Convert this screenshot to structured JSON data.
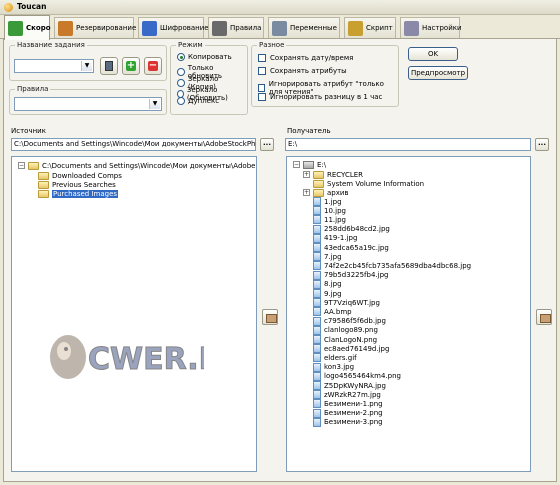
{
  "window": {
    "title": "Toucan"
  },
  "tabs": [
    {
      "label": "Скоро",
      "color": "#3a9a3a",
      "active": true
    },
    {
      "label": "Резервирование",
      "color": "#c87a2a"
    },
    {
      "label": "Шифрование",
      "color": "#3a6ac8"
    },
    {
      "label": "Правила",
      "color": "#6a6a6a"
    },
    {
      "label": "Переменные",
      "color": "#7a8aa0"
    },
    {
      "label": "Скрипт",
      "color": "#c8a030"
    },
    {
      "label": "Настройки",
      "color": "#8a8aa8"
    }
  ],
  "job": {
    "legend": "Название задания",
    "value": ""
  },
  "rules": {
    "legend": "Правила",
    "value": ""
  },
  "mode": {
    "legend": "Режим",
    "options": [
      "Копировать",
      "Только обновить",
      "Зеркало (Копия)",
      "Зеркало (Обновить)",
      "Дуплекс"
    ],
    "selected_index": 0
  },
  "misc": {
    "legend": "Разное",
    "options": [
      "Сохранять дату/время",
      "Сохранять атрибуты",
      "Игнорировать атрибут \"только для чтения\"",
      "Игнорировать разницу в 1 час"
    ]
  },
  "buttons": {
    "ok": "OK",
    "preview": "Предпросмотр",
    "browse": "..."
  },
  "source": {
    "label": "Источник",
    "path": "C:\\Documents and Settings\\Wincode\\Мои документы\\AdobeStockPhotos",
    "root": "C:\\Documents and Settings\\Wincode\\Мои документы\\AdobeStockPhotos",
    "children": [
      "Downloaded Comps",
      "Previous Searches",
      "Purchased Images"
    ],
    "selected": "Purchased Images"
  },
  "dest": {
    "label": "Получатель",
    "path": "E:\\",
    "root": "E:\\",
    "folders": [
      "RECYCLER",
      "System Volume Information",
      "архив"
    ],
    "files": [
      "1.jpg",
      "10.jpg",
      "11.jpg",
      "258dd6b48cd2.jpg",
      "419-1.jpg",
      "43edca65a19c.jpg",
      "7.jpg",
      "74f2e2cb45fcb735afa5689dba4dbc68.jpg",
      "79b5d3225fb4.jpg",
      "8.jpg",
      "9.jpg",
      "9T7Vziq6WT.jpg",
      "AA.bmp",
      "c79586f5f6db.jpg",
      "clanlogo89.png",
      "ClanLogoN.png",
      "ec8aed76149d.jpg",
      "elders.gif",
      "kon3.jpg",
      "logo4565464km4.png",
      "Z5DpKWyNRA.jpg",
      "zWRzkR27m.jpg",
      "Безимени-1.png",
      "Безимени-2.png",
      "Безимени-3.png"
    ]
  },
  "watermark": {
    "text": "CWER.RU"
  }
}
